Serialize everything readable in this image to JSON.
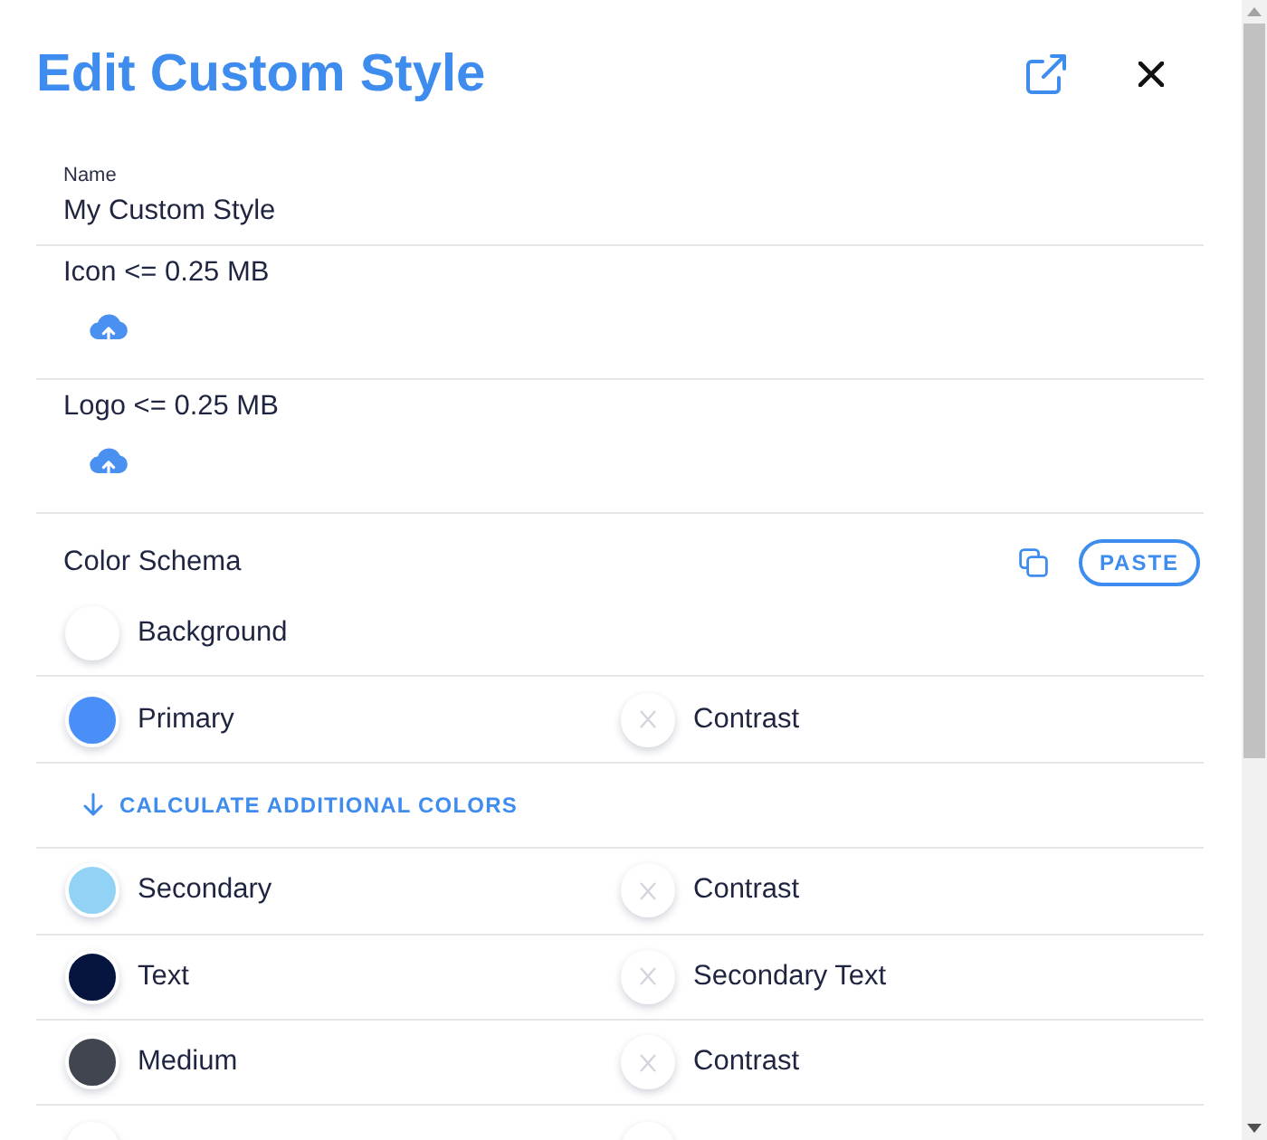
{
  "dialog": {
    "title": "Edit Custom Style"
  },
  "name_field": {
    "label": "Name",
    "value": "My Custom Style"
  },
  "uploads": [
    {
      "label": "Icon <= 0.25 MB"
    },
    {
      "label": "Logo <= 0.25 MB"
    }
  ],
  "color_schema": {
    "title": "Color Schema",
    "paste_button": "PASTE",
    "rows": [
      {
        "kind": "color",
        "main": {
          "label": "Background",
          "color": "#ffffff"
        }
      },
      {
        "kind": "color",
        "main": {
          "label": "Primary",
          "color": "#4a8ff7"
        },
        "contrast": {
          "label": "Contrast",
          "empty": true
        }
      },
      {
        "kind": "action",
        "label": "CALCULATE ADDITIONAL COLORS"
      },
      {
        "kind": "color",
        "main": {
          "label": "Secondary",
          "color": "#92d2f4"
        },
        "contrast": {
          "label": "Contrast",
          "empty": true
        }
      },
      {
        "kind": "color",
        "main": {
          "label": "Text",
          "color": "#061540"
        },
        "contrast": {
          "label": "Secondary Text",
          "empty": true
        }
      },
      {
        "kind": "color",
        "main": {
          "label": "Medium",
          "color": "#40454f"
        },
        "contrast": {
          "label": "Contrast",
          "empty": true
        }
      },
      {
        "kind": "color",
        "main": {
          "color": "#ffffff"
        },
        "contrast": {
          "color": "#ffffff"
        }
      }
    ]
  }
}
